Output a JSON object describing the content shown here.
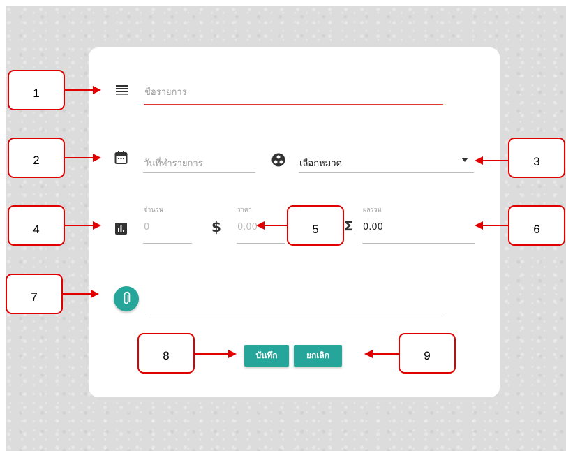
{
  "form": {
    "item_name_placeholder": "ชื่อรายการ",
    "date_placeholder": "วันที่ทำรายการ",
    "category_value": "เลือกหมวด",
    "quantity_label": "จำนวน",
    "quantity_value": "0",
    "price_label": "ราคา",
    "price_value": "0.00",
    "total_label": "ผลรวม",
    "total_value": "0.00",
    "currency_symbol": "$",
    "sum_symbol": "Σ"
  },
  "buttons": {
    "save_label": "บันทึก",
    "cancel_label": "ยกเลิก"
  },
  "callouts": [
    "1",
    "2",
    "3",
    "4",
    "5",
    "6",
    "7",
    "8",
    "9"
  ],
  "colors": {
    "accent": "#26a69a",
    "underline_active": "#e53935",
    "callout_red": "#e00000"
  },
  "icons": [
    "list-icon",
    "calendar-icon",
    "category-icon",
    "dropdown-arrow-icon",
    "bar-chart-icon",
    "dollar-icon",
    "sigma-icon",
    "attach-icon"
  ]
}
